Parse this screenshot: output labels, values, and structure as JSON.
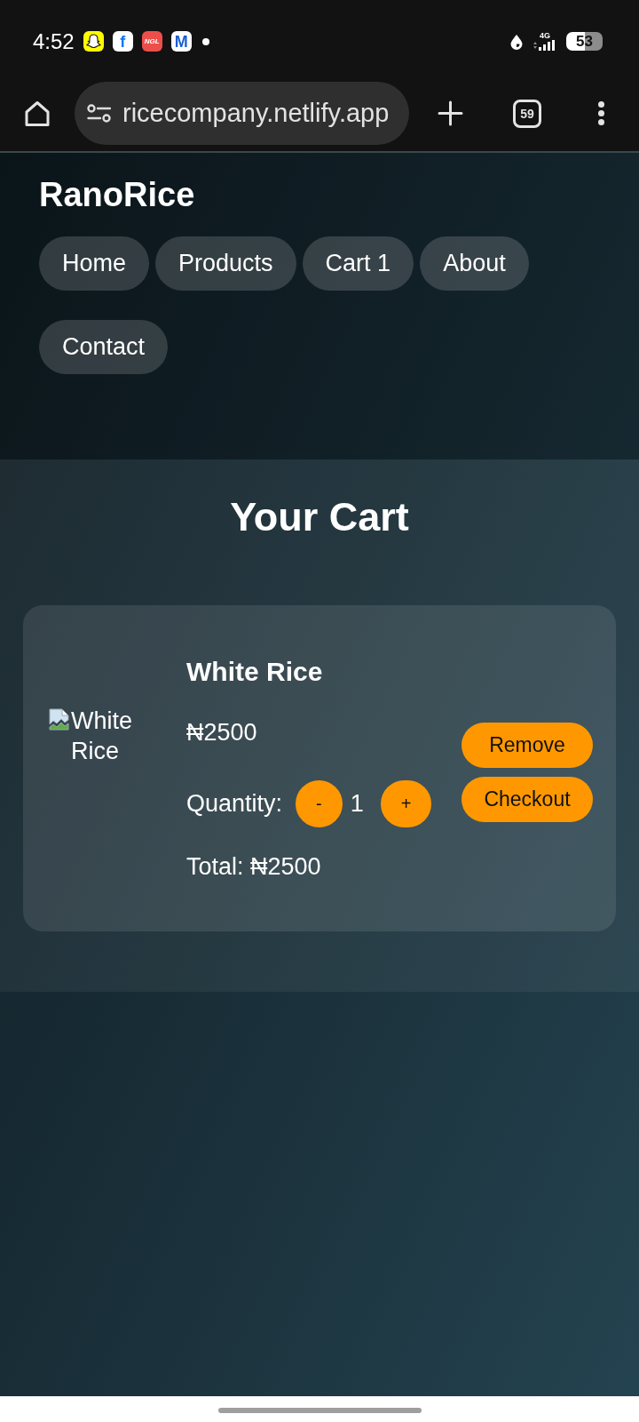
{
  "status_bar": {
    "time": "4:52",
    "notifications": [
      {
        "kind": "ghost",
        "color": "#fffc00"
      },
      {
        "kind": "letter",
        "glyph": "f",
        "color": "#1877f2"
      },
      {
        "kind": "label",
        "glyph": "NGL",
        "color": "#ec4f4a"
      },
      {
        "kind": "letter",
        "glyph": "M",
        "color": "#1a5fd0"
      },
      {
        "kind": "dot"
      }
    ],
    "network": "4G",
    "battery": "53"
  },
  "browser": {
    "url": "ricecompany.netlify.app",
    "tab_count": "59"
  },
  "header": {
    "logo": "RanoRice",
    "nav": [
      {
        "label": "Home"
      },
      {
        "label": "Products"
      },
      {
        "label": "Cart 1"
      },
      {
        "label": "About"
      },
      {
        "label": "Contact"
      }
    ]
  },
  "cart": {
    "title": "Your Cart",
    "items": [
      {
        "image_alt": "White Rice",
        "name": "White Rice",
        "price": "₦2500",
        "quantity_label": "Quantity:",
        "decrease": "-",
        "quantity": "1",
        "increase": "+",
        "total": "Total: ₦2500",
        "remove": "Remove",
        "checkout": "Checkout"
      }
    ]
  }
}
